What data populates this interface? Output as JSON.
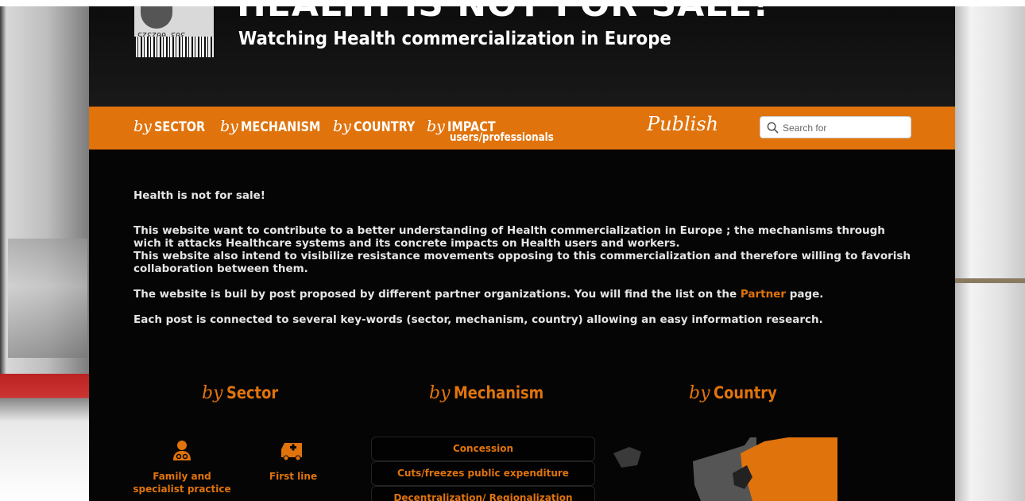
{
  "header": {
    "title": "HEALTH IS NOT FOR SALE!",
    "subtitle": "Watching Health commercialization in Europe",
    "logo_code": "303 002325"
  },
  "nav": {
    "by_word": "by",
    "items": [
      {
        "label": "SECTOR"
      },
      {
        "label": "MECHANISM"
      },
      {
        "label": "COUNTRY"
      },
      {
        "label": "IMPACT",
        "sublabel": "users/professionals"
      }
    ],
    "publish": "Publish",
    "search_placeholder": "Search for"
  },
  "content": {
    "heading": "Health is not for sale!",
    "para1": "This website want to contribute to a better understanding of Health commercialization in Europe ; the mechanisms through wich it attacks Healthcare systems and its concrete impacts on Health users and workers.",
    "para1b": "This website also intend to visibilize resistance movements opposing to this commercialization and therefore willing to favorish collaboration between them.",
    "para2_before": "The website is buil by post proposed by different partner organizations. You will find the list on the ",
    "para2_link": "Partner",
    "para2_after": " page.",
    "para3": "Each post is connected to several key-words (sector, mechanism, country) allowing an easy information research."
  },
  "sections": {
    "by_word": "by",
    "sector_title": "Sector",
    "mechanism_title": "Mechanism",
    "country_title": "Country"
  },
  "sector_items": [
    {
      "label_line1": "Family and",
      "label_line2": "specialist practice",
      "icon": "doctor-icon"
    },
    {
      "label_line1": "First line",
      "label_line2": "",
      "icon": "ambulance-icon"
    }
  ],
  "mechanism_items": [
    "Concession",
    "Cuts/freezes public expenditure",
    "Decentralization/ Regionalization"
  ],
  "colors": {
    "accent": "#e0730c",
    "background": "#050505",
    "text": "#e5e5e5"
  }
}
